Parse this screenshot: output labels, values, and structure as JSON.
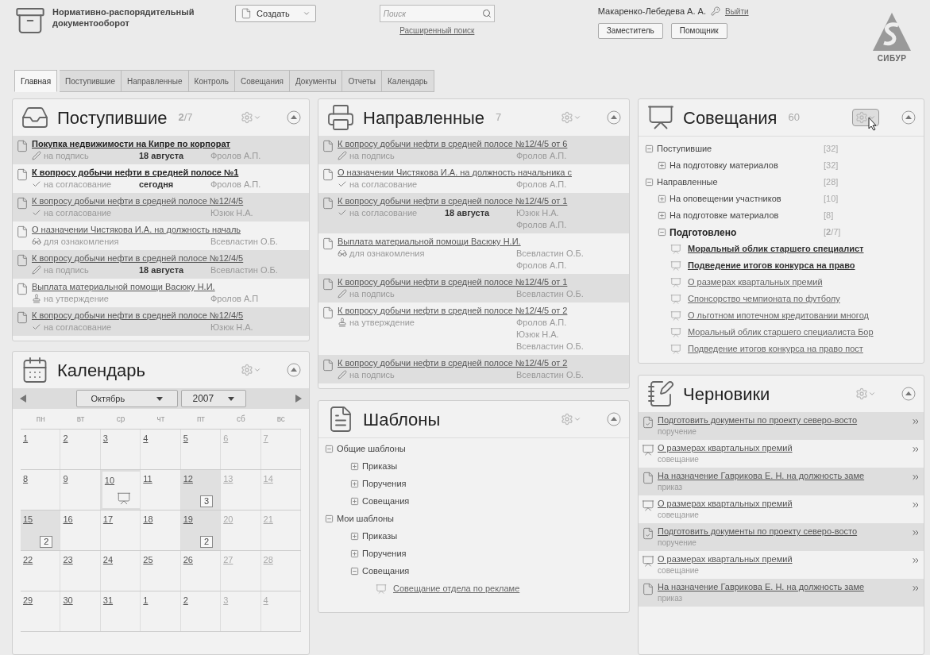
{
  "header": {
    "title": "Нормативно-распорядительный документооборот",
    "create_button": "Создать",
    "search": {
      "placeholder": "Поиск"
    },
    "advanced_search": "Расширенный поиск",
    "user": "Макаренко-Лебедева А. А.",
    "logout": "Выйти",
    "buttons": [
      "Заместитель",
      "Помощник"
    ],
    "logo": "СИБУР"
  },
  "tabs": [
    {
      "label": "Главная",
      "selected": true
    },
    {
      "label": "Поступившие",
      "selected": false
    },
    {
      "label": "Направленные",
      "selected": false
    },
    {
      "label": "Контроль",
      "selected": false
    },
    {
      "label": "Совещания",
      "selected": false
    },
    {
      "label": "Документы",
      "selected": false
    },
    {
      "label": "Отчеты",
      "selected": false
    },
    {
      "label": "Календарь",
      "selected": false
    }
  ],
  "incoming": {
    "title": "Поступившие",
    "counter": "**2**/7",
    "rows": [
      {
        "title": "Покупка недвижимости на Кипре по корпорат",
        "unread": true,
        "kind": "sign",
        "action": "на подпись",
        "date": "18 августа",
        "people": [
          "Фролов А.П."
        ]
      },
      {
        "title": "К вопросу добычи нефти в средней полосе №1",
        "unread": true,
        "kind": "approve",
        "action": "на согласование",
        "date": "сегодня",
        "people": [
          "Фролов А.П."
        ]
      },
      {
        "title": "К вопросу добычи нефти в средней полосе №12/4/5",
        "unread": false,
        "kind": "approve",
        "action": "на согласование",
        "people": [
          "Юзюк Н.А."
        ]
      },
      {
        "title": "О назначении Чистякова И.А. на должность началь",
        "unread": false,
        "kind": "review",
        "action": "для ознакомления",
        "people": [
          "Всевластин О.Б."
        ]
      },
      {
        "title": "К вопросу добычи нефти в средней полосе №12/4/5",
        "unread": false,
        "kind": "sign",
        "action": "на подпись",
        "date": "18 августа",
        "people": [
          "Всевластин О.Б."
        ]
      },
      {
        "title": "Выплата материальной помощи Васюку Н.И.",
        "unread": false,
        "kind": "confirm",
        "action": "на утверждение",
        "people": [
          "Фролов А.П"
        ]
      },
      {
        "title": "К вопросу добычи нефти в средней полосе №12/4/5",
        "unread": false,
        "kind": "approve",
        "action": "на согласование",
        "people": [
          "Юзюк Н.А."
        ]
      }
    ]
  },
  "calendar": {
    "title": "Календарь",
    "month": "Октябрь",
    "year": "2007",
    "weekdays": [
      "пн",
      "вт",
      "ср",
      "чт",
      "пт",
      "сб",
      "вс"
    ],
    "weeks": [
      [
        {
          "day": "1"
        },
        {
          "day": "2"
        },
        {
          "day": "3"
        },
        {
          "day": "4"
        },
        {
          "day": "5"
        },
        {
          "day": "6"
        },
        {
          "day": "7"
        }
      ],
      [
        {
          "day": "8"
        },
        {
          "day": "9"
        },
        {
          "day": "10",
          "selected": true,
          "meeting": true
        },
        {
          "day": "11"
        },
        {
          "day": "12",
          "meeting": true,
          "meeting_count": "3"
        },
        {
          "day": "13"
        },
        {
          "day": "14"
        }
      ],
      [
        {
          "day": "15",
          "meeting": true,
          "meeting_count": "2"
        },
        {
          "day": "16"
        },
        {
          "day": "17"
        },
        {
          "day": "18"
        },
        {
          "day": "19",
          "meeting": true,
          "meeting_count": "2"
        },
        {
          "day": "20"
        },
        {
          "day": "21"
        }
      ],
      [
        {
          "day": "22"
        },
        {
          "day": "23"
        },
        {
          "day": "24"
        },
        {
          "day": "25"
        },
        {
          "day": "26"
        },
        {
          "day": "27"
        },
        {
          "day": "28"
        }
      ],
      [
        {
          "day": "29"
        },
        {
          "day": "30"
        },
        {
          "day": "31"
        },
        {
          "day": "1"
        },
        {
          "day": "2"
        },
        {
          "day": "3"
        },
        {
          "day": "4"
        }
      ]
    ]
  },
  "sent": {
    "title": "Направленные",
    "counter": "7",
    "rows": [
      {
        "title": "К вопросу добычи нефти в средней полосе №12/4/5 от 6",
        "unread": false,
        "kind": "sign",
        "action": "на подпись",
        "people": [
          "Фролов А.П."
        ]
      },
      {
        "title": "О назначении Чистякова И.А. на должность начальника с",
        "unread": false,
        "kind": "approve",
        "action": "на согласование",
        "people": [
          "Фролов А.П."
        ]
      },
      {
        "title": "К вопросу добычи нефти в средней полосе №12/4/5 от 1",
        "unread": false,
        "kind": "approve",
        "action": "на согласование",
        "date": "18 августа",
        "people": [
          "Юзюк Н.А.",
          "Фролов А.П."
        ]
      },
      {
        "title": "Выплата материальной помощи Васюку Н.И.",
        "unread": false,
        "kind": "review",
        "action": "для ознакомления",
        "people": [
          "Всевластин О.Б.",
          "Фролов А.П."
        ]
      },
      {
        "title": "К вопросу добычи нефти в средней полосе №12/4/5 от 1",
        "unread": false,
        "kind": "sign",
        "action": "на подпись",
        "people": [
          "Всевластин О.Б."
        ]
      },
      {
        "title": "К вопросу добычи нефти в средней полосе №12/4/5 от 2",
        "unread": false,
        "kind": "confirm",
        "action": "на утверждение",
        "people": [
          "Фролов А.П.",
          "Юзюк Н.А.",
          "Всевластин О.Б."
        ]
      },
      {
        "title": "К вопросу добычи нефти в средней полосе №12/4/5 от 2",
        "unread": false,
        "kind": "sign",
        "action": "на подпись",
        "people": [
          "Всевластин О.Б."
        ]
      }
    ]
  },
  "templates": {
    "title": "Шаблоны",
    "tree": [
      {
        "label": "Общие шаблоны",
        "expanded": true,
        "children": [
          {
            "label": "Приказы",
            "expanded": false
          },
          {
            "label": "Поручения",
            "expanded": false
          },
          {
            "label": "Совещания",
            "expanded": false
          }
        ]
      },
      {
        "label": "Мои шаблоны",
        "expanded": true,
        "children": [
          {
            "label": "Приказы",
            "expanded": false
          },
          {
            "label": "Поручения",
            "expanded": false
          },
          {
            "label": "Совещания",
            "expanded": true,
            "children": [
              {
                "label": "Совещание отдела по рекламе",
                "unread": false
              }
            ]
          }
        ]
      }
    ]
  },
  "meetings": {
    "title": "Совещания",
    "counter": "60",
    "settings_hovered": true,
    "tree": [
      {
        "label": "Поступившие",
        "expanded": true,
        "count": "[32]",
        "children": [
          {
            "label": "На подготовку материалов",
            "expanded": false,
            "count": "[32]"
          }
        ]
      },
      {
        "label": "Направленные",
        "expanded": true,
        "count": "[28]",
        "children": [
          {
            "label": "На оповещении участников",
            "expanded": false,
            "count": "[10]"
          },
          {
            "label": "На подготовке материалов",
            "expanded": false,
            "count": "[8]"
          },
          {
            "label": "Подготовлено",
            "expanded": true,
            "unread": true,
            "count": "[**2**/7]",
            "children": [
              {
                "label": "Моральный облик старшего специалист",
                "unread": true
              },
              {
                "label": "Подведение итогов конкурса на право",
                "unread": true
              },
              {
                "label": "О размерах квартальных премий",
                "unread": false
              },
              {
                "label": "Спонсорство чемпионата по футболу",
                "unread": false
              },
              {
                "label": "О льготном ипотечном кредитовании многод",
                "unread": false
              },
              {
                "label": "Моральный облик старшего специалиста Бор",
                "unread": false
              },
              {
                "label": "Подведение итогов конкурса на право пост",
                "unread": false
              }
            ]
          }
        ]
      }
    ]
  },
  "drafts": {
    "title": "Черновики",
    "rows": [
      {
        "title": "Подготовить документы по проекту северо-восто",
        "type": "поручение",
        "kind": "task"
      },
      {
        "title": "О размерах квартальных премий",
        "type": "совещание",
        "kind": "meeting"
      },
      {
        "title": "На назначение Гаврикова Е. Н. на должность заме",
        "type": "приказ",
        "kind": "order"
      },
      {
        "title": "О размерах квартальных премий",
        "type": "совещание",
        "kind": "meeting"
      },
      {
        "title": "Подготовить документы по проекту северо-восто",
        "type": "поручение",
        "kind": "task"
      },
      {
        "title": "О размерах квартальных премий",
        "type": "совещание",
        "kind": "meeting"
      },
      {
        "title": "На назначение Гаврикова Е. Н. на должность заме",
        "type": "приказ",
        "kind": "order"
      }
    ]
  }
}
